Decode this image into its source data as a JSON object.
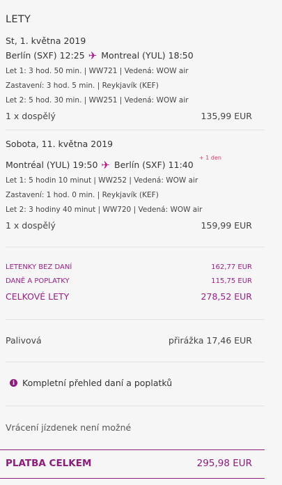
{
  "title": "LETY",
  "flights": [
    {
      "date": "St, 1. května 2019",
      "origin": "Berlín (SXF) 12:25",
      "destination": "Montreal (YUL) 18:50",
      "next_day": "",
      "legs": [
        "Let 1: 3 hod. 50 min. | WW721 | Vedená: WOW air",
        "Zastavení: 3 hod. 5 min. | Reykjavík (KEF)",
        "Let 2: 5 hod. 30 min. | WW251 | Vedená: WOW air"
      ],
      "passengers": "1 x dospělý",
      "price": "135,99 EUR"
    },
    {
      "date": "Sobota, 11. května 2019",
      "origin": "Montréal (YUL) 19:50",
      "destination": "Berlín (SXF) 11:40",
      "next_day": "+ 1 den",
      "legs": [
        "Let 1: 5 hodin 10 minut | WW252 | Vedená: WOW air",
        "Zastavení: 1 hod. 0 min. | Reykjavík (KEF)",
        "Let 2: 3 hodiny 40 minut | WW720 | Vedená: WOW air"
      ],
      "passengers": "1 x dospělý",
      "price": "159,99 EUR"
    }
  ],
  "totals": {
    "tickets_label": "Letenky bez daní",
    "tickets_value": "162,77 EUR",
    "taxes_label": "Daně a poplatky",
    "taxes_value": "115,75 EUR",
    "flights_total_label": "Celkové lety",
    "flights_total_value": "278,52 EUR"
  },
  "fuel": {
    "label": "Palivová",
    "value": "přirážka 17,46 EUR"
  },
  "overview_link": "Kompletní přehled daní a poplatků",
  "refund_note": "Vrácení jízdenek není možné",
  "grand_total": {
    "label": "Platba celkem",
    "value": "295,98 EUR"
  },
  "colors": {
    "accent": "#8e1c7c",
    "plane": "#b11b8c",
    "next_day": "#d9376e"
  },
  "icons": {
    "plane": "airplane-icon",
    "info": "info-icon"
  }
}
